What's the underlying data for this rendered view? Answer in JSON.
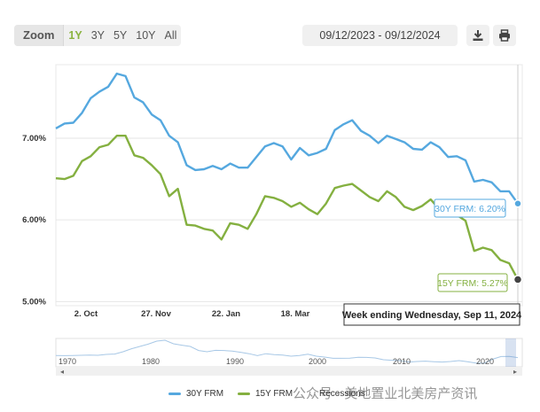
{
  "toolbar": {
    "zoom_label": "Zoom",
    "ranges": [
      "1Y",
      "3Y",
      "5Y",
      "10Y",
      "All"
    ],
    "active_range": "1Y",
    "date_range": "09/12/2023 - 09/12/2024",
    "download_icon": "download-icon",
    "print_icon": "print-icon"
  },
  "colors": {
    "frm30": "#55a8df",
    "frm15": "#84b040",
    "tooltip_border": "#333333",
    "navigator": "#a8c8e6"
  },
  "chart_data": {
    "type": "line",
    "x_tick_labels": [
      "2. Oct",
      "27. Nov",
      "22. Jan",
      "18. Mar"
    ],
    "y_tick_labels": [
      "7.00%",
      "6.00%",
      "5.00%"
    ],
    "y_ticks": [
      7.0,
      6.0,
      5.0
    ],
    "ylim": [
      4.95,
      7.9
    ],
    "grid": true,
    "series": [
      {
        "name": "30Y FRM",
        "label": "30Y FRM: 6.20%",
        "values": [
          7.12,
          7.18,
          7.19,
          7.31,
          7.49,
          7.57,
          7.63,
          7.79,
          7.76,
          7.5,
          7.44,
          7.29,
          7.22,
          7.03,
          6.95,
          6.67,
          6.61,
          6.62,
          6.66,
          6.62,
          6.69,
          6.64,
          6.64,
          6.77,
          6.9,
          6.94,
          6.9,
          6.74,
          6.88,
          6.79,
          6.82,
          6.87,
          7.1,
          7.17,
          7.22,
          7.09,
          7.03,
          6.94,
          7.03,
          6.99,
          6.95,
          6.87,
          6.86,
          6.95,
          6.89,
          6.77,
          6.78,
          6.73,
          6.47,
          6.49,
          6.46,
          6.35,
          6.35,
          6.2
        ]
      },
      {
        "name": "15Y FRM",
        "label": "15Y FRM: 5.27%",
        "values": [
          6.51,
          6.5,
          6.54,
          6.72,
          6.78,
          6.89,
          6.92,
          7.03,
          7.03,
          6.79,
          6.76,
          6.67,
          6.56,
          6.29,
          6.38,
          5.94,
          5.93,
          5.89,
          5.87,
          5.76,
          5.96,
          5.94,
          5.89,
          6.07,
          6.29,
          6.27,
          6.23,
          6.16,
          6.21,
          6.13,
          6.07,
          6.2,
          6.39,
          6.42,
          6.44,
          6.36,
          6.28,
          6.23,
          6.35,
          6.28,
          6.16,
          6.12,
          6.17,
          6.25,
          6.13,
          6.08,
          6.06,
          5.99,
          5.62,
          5.66,
          5.63,
          5.51,
          5.47,
          5.27
        ]
      }
    ],
    "tooltip": "Week ending Wednesday, Sep 11, 2024",
    "navigator": {
      "ticks": [
        "1970",
        "1980",
        "1990",
        "2000",
        "2010",
        "2020"
      ],
      "values": [
        7.4,
        7.3,
        7.4,
        7.5,
        7.6,
        7.5,
        8.0,
        8.2,
        9.5,
        11.2,
        12.5,
        13.8,
        15.5,
        16.0,
        14.0,
        13.2,
        12.5,
        10.2,
        9.5,
        10.3,
        10.2,
        9.9,
        9.2,
        8.4,
        7.3,
        8.4,
        7.9,
        7.6,
        7.0,
        7.4,
        8.1,
        7.0,
        6.5,
        5.8,
        5.8,
        5.9,
        6.4,
        6.3,
        6.0,
        5.0,
        4.7,
        4.5,
        3.7,
        4.0,
        4.2,
        3.9,
        3.7,
        4.0,
        4.5,
        3.9,
        3.1,
        3.0,
        5.3,
        6.8,
        6.9,
        6.2
      ]
    }
  },
  "legend": {
    "frm30": "30Y FRM",
    "frm15": "15Y FRM",
    "recessions": "Recessions"
  },
  "watermark": "公众号 · 美地置业北美房产资讯"
}
